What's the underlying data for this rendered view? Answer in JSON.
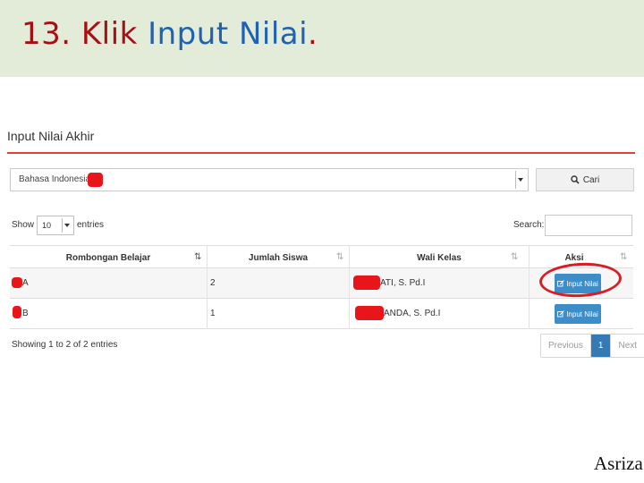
{
  "slide": {
    "step": "13.",
    "word_klik": "Klik",
    "word_input_nilai": "Input Nilai",
    "period": ".",
    "footer": "Asriza"
  },
  "panel": {
    "title": "Input Nilai Akhir",
    "subject_select_value": "Bahasa Indonesia -",
    "cari_label": "Cari",
    "show_label": "Show",
    "page_length": "10",
    "entries_label": "entries",
    "search_label": "Search:",
    "search_value": "",
    "columns": [
      "Rombongan Belajar",
      "Jumlah Siswa",
      "Wali Kelas",
      "Aksi"
    ],
    "rows": [
      {
        "rombel": "A",
        "jumlah": "2",
        "wali": "ATI, S. Pd.I",
        "aksi": "Input Nilai"
      },
      {
        "rombel": "B",
        "jumlah": "1",
        "wali": "ANDA, S. Pd.I",
        "aksi": "Input Nilai"
      }
    ],
    "info": "Showing 1 to 2 of 2 entries",
    "pagination": {
      "previous": "Previous",
      "current": "1",
      "next": "Next"
    }
  },
  "colors": {
    "title_red": "#a80f14",
    "title_blue": "#1f62b3",
    "header_bg": "#e2ecd8",
    "button_blue": "#3c8dc8",
    "highlight_red": "#d51f26"
  },
  "icons": [
    "search-icon",
    "edit-icon",
    "sort-icon",
    "caret-down-icon"
  ]
}
